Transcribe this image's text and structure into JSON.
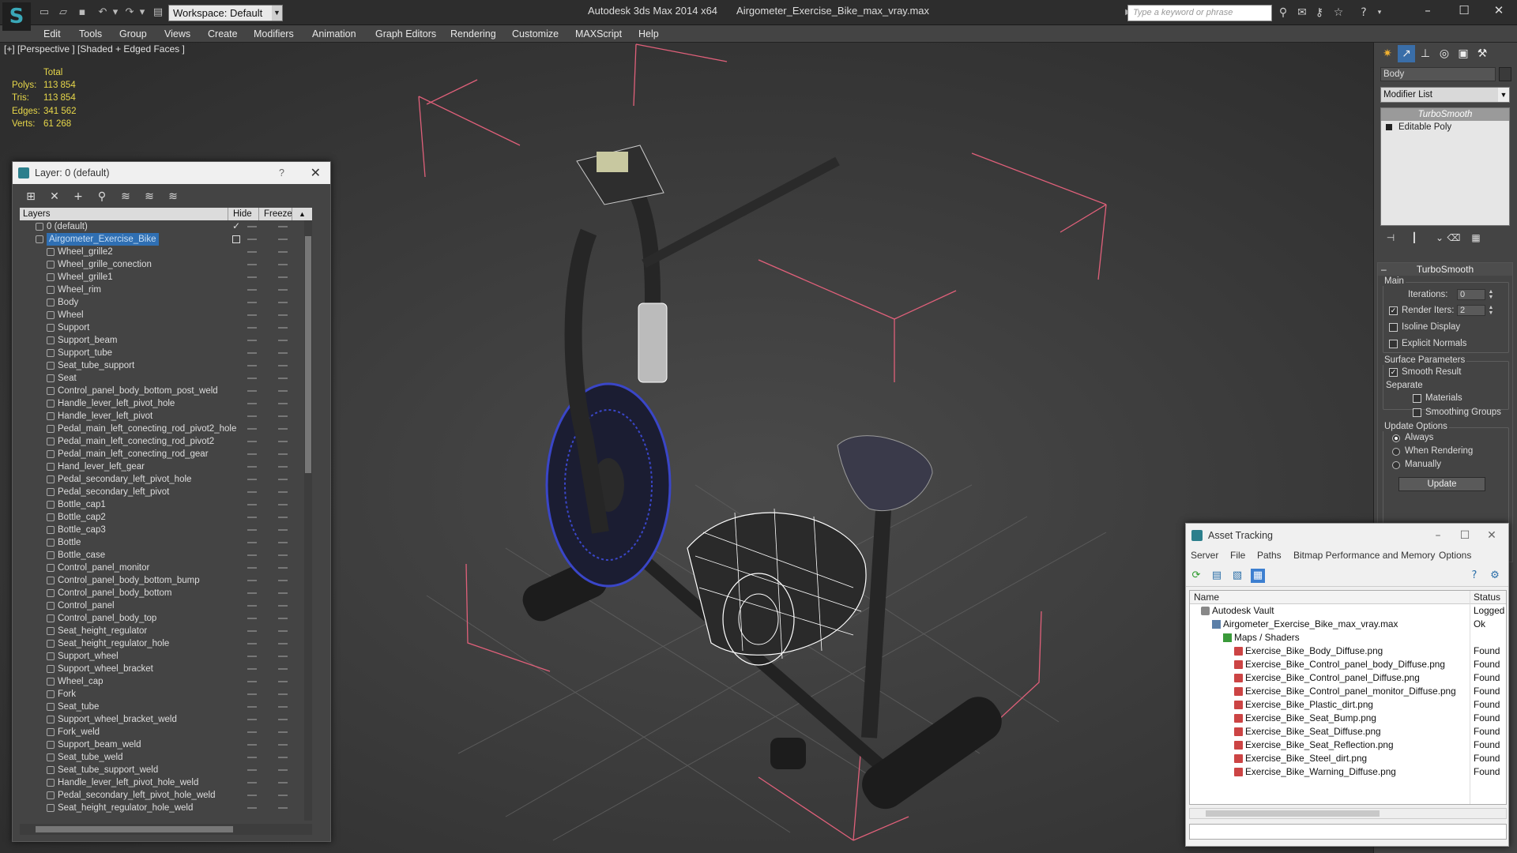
{
  "app": {
    "name": "Autodesk 3ds Max  2014 x64",
    "file": "Airgometer_Exercise_Bike_max_vray.max",
    "workspace": "Workspace: Default",
    "search_placeholder": "Type a keyword or phrase"
  },
  "menu": [
    "Edit",
    "Tools",
    "Group",
    "Views",
    "Create",
    "Modifiers",
    "Animation",
    "Graph Editors",
    "Rendering",
    "Customize",
    "MAXScript",
    "Help"
  ],
  "viewport": {
    "label": "[+] [Perspective ] [Shaded + Edged Faces ]",
    "stats": {
      "header": "Total",
      "rows": [
        {
          "k": "Polys:",
          "v": "113 854"
        },
        {
          "k": "Tris:",
          "v": "113 854"
        },
        {
          "k": "Edges:",
          "v": "341 562"
        },
        {
          "k": "Verts:",
          "v": "61 268"
        }
      ]
    }
  },
  "layer_window": {
    "title": "Layer: 0 (default)",
    "help": "?",
    "columns": {
      "layers": "Layers",
      "hide": "Hide",
      "freeze": "Freeze"
    },
    "layers": [
      {
        "name": "0 (default)"
      },
      {
        "name": "Airgometer_Exercise_Bike"
      }
    ],
    "objects": [
      "Wheel_grille2",
      "Wheel_grille_conection",
      "Wheel_grille1",
      "Wheel_rim",
      "Body",
      "Wheel",
      "Support",
      "Support_beam",
      "Support_tube",
      "Seat_tube_support",
      "Seat",
      "Control_panel_body_bottom_post_weld",
      "Handle_lever_left_pivot_hole",
      "Handle_lever_left_pivot",
      "Pedal_main_left_conecting_rod_pivot2_hole",
      "Pedal_main_left_conecting_rod_pivot2",
      "Pedal_main_left_conecting_rod_gear",
      "Hand_lever_left_gear",
      "Pedal_secondary_left_pivot_hole",
      "Pedal_secondary_left_pivot",
      "Bottle_cap1",
      "Bottle_cap2",
      "Bottle_cap3",
      "Bottle",
      "Bottle_case",
      "Control_panel_monitor",
      "Control_panel_body_bottom_bump",
      "Control_panel_body_bottom",
      "Control_panel",
      "Control_panel_body_top",
      "Seat_height_regulator",
      "Seat_height_regulator_hole",
      "Support_wheel",
      "Support_wheel_bracket",
      "Wheel_cap",
      "Fork",
      "Seat_tube",
      "Support_wheel_bracket_weld",
      "Fork_weld",
      "Support_beam_weld",
      "Seat_tube_weld",
      "Seat_tube_support_weld",
      "Handle_lever_left_pivot_hole_weld",
      "Pedal_secondary_left_pivot_hole_weld",
      "Seat_height_regulator_hole_weld"
    ]
  },
  "command_panel": {
    "object_name": "Body",
    "modifier_list": "Modifier List",
    "stack": [
      "TurboSmooth",
      "Editable Poly"
    ],
    "rollout_title": "TurboSmooth",
    "main_label": "Main",
    "iterations_label": "Iterations:",
    "iterations_value": "0",
    "render_iters_label": "Render Iters:",
    "render_iters_value": "2",
    "isoline": "Isoline Display",
    "explicit_normals": "Explicit Normals",
    "surface_label": "Surface Parameters",
    "smooth_result": "Smooth Result",
    "separate_label": "Separate",
    "materials": "Materials",
    "smoothing_groups": "Smoothing Groups",
    "update_label": "Update Options",
    "always": "Always",
    "when_rendering": "When Rendering",
    "manually": "Manually",
    "update_button": "Update"
  },
  "asset_tracking": {
    "title": "Asset Tracking",
    "menu": [
      "Server",
      "File",
      "Paths",
      "Bitmap Performance and Memory",
      "Options"
    ],
    "col_name": "Name",
    "col_status": "Status",
    "rows": [
      {
        "name": "Autodesk Vault",
        "status": "Logged",
        "indent": 0,
        "icon": "vault"
      },
      {
        "name": "Airgometer_Exercise_Bike_max_vray.max",
        "status": "Ok",
        "indent": 1,
        "icon": "file"
      },
      {
        "name": "Maps / Shaders",
        "status": "",
        "indent": 2,
        "icon": "folder"
      },
      {
        "name": "Exercise_Bike_Body_Diffuse.png",
        "status": "Found",
        "indent": 3,
        "icon": "png"
      },
      {
        "name": "Exercise_Bike_Control_panel_body_Diffuse.png",
        "status": "Found",
        "indent": 3,
        "icon": "png"
      },
      {
        "name": "Exercise_Bike_Control_panel_Diffuse.png",
        "status": "Found",
        "indent": 3,
        "icon": "png"
      },
      {
        "name": "Exercise_Bike_Control_panel_monitor_Diffuse.png",
        "status": "Found",
        "indent": 3,
        "icon": "png"
      },
      {
        "name": "Exercise_Bike_Plastic_dirt.png",
        "status": "Found",
        "indent": 3,
        "icon": "png"
      },
      {
        "name": "Exercise_Bike_Seat_Bump.png",
        "status": "Found",
        "indent": 3,
        "icon": "png"
      },
      {
        "name": "Exercise_Bike_Seat_Diffuse.png",
        "status": "Found",
        "indent": 3,
        "icon": "png"
      },
      {
        "name": "Exercise_Bike_Seat_Reflection.png",
        "status": "Found",
        "indent": 3,
        "icon": "png"
      },
      {
        "name": "Exercise_Bike_Steel_dirt.png",
        "status": "Found",
        "indent": 3,
        "icon": "png"
      },
      {
        "name": "Exercise_Bike_Warning_Diffuse.png",
        "status": "Found",
        "indent": 3,
        "icon": "png"
      }
    ]
  },
  "colors": {
    "selection": "#2f6fb3",
    "stats_text": "#e8d84a",
    "bounding_box": "#e0607a",
    "wheel_wire": "#3a46c8"
  }
}
